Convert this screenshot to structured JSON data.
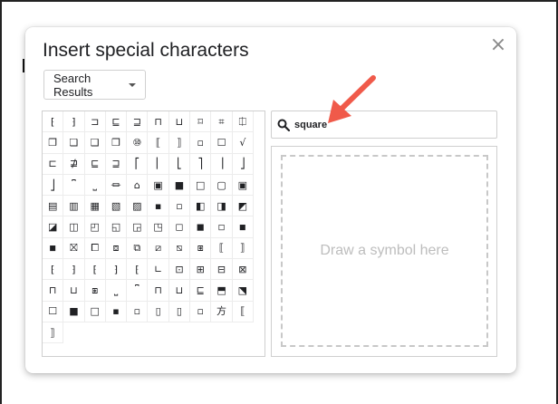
{
  "dialog": {
    "title": "Insert special characters",
    "close_glyph": "×"
  },
  "category_dropdown": {
    "selected": "Search Results"
  },
  "search": {
    "value": "square"
  },
  "drawing_area": {
    "placeholder": "Draw a symbol here"
  },
  "symbols": [
    "⁅",
    "⁆",
    "⊐",
    "⊑",
    "⊒",
    "⊓",
    "⊔",
    "⌑",
    "⌗",
    "⎅",
    "❐",
    "❏",
    "❑",
    "❒",
    "⑩",
    "⟦",
    "⟧",
    "▫",
    "☐",
    "√",
    "⊏",
    "⋣",
    "⊑",
    "⊒",
    "⎡",
    "⎢",
    "⎣",
    "⎤",
    "⎥",
    "⎦",
    "⎦",
    "⎴",
    "⎵",
    "⏛",
    "⌂",
    "▣",
    "■",
    "□",
    "▢",
    "▣",
    "▤",
    "▥",
    "▦",
    "▧",
    "▨",
    "▪",
    "▫",
    "◧",
    "◨",
    "◩",
    "◪",
    "◫",
    "◰",
    "◱",
    "◲",
    "◳",
    "◻",
    "◼",
    "◽",
    "◾",
    "◾",
    "⛝",
    "⧠",
    "⧈",
    "⧉",
    "⧄",
    "⧅",
    "⧆",
    "⟦",
    "⟧",
    "⁅",
    "⁆",
    "⁅",
    "⁆",
    "⁅",
    "∟",
    "⊡",
    "⊞",
    "⊟",
    "⊠",
    "⊓",
    "⊔",
    "⧆",
    "⎵",
    "⎴",
    "⊓",
    "⊔",
    "⊑",
    "⬒",
    "⬔",
    "☐",
    "■",
    "□",
    "▪",
    "▫",
    "▯",
    "▯",
    "▫",
    "方",
    "⟦",
    "⟧"
  ],
  "colors": {
    "accent_arrow": "#f05a4a",
    "border": "#cfcfcf",
    "placeholder_text": "#bdbdbd"
  }
}
